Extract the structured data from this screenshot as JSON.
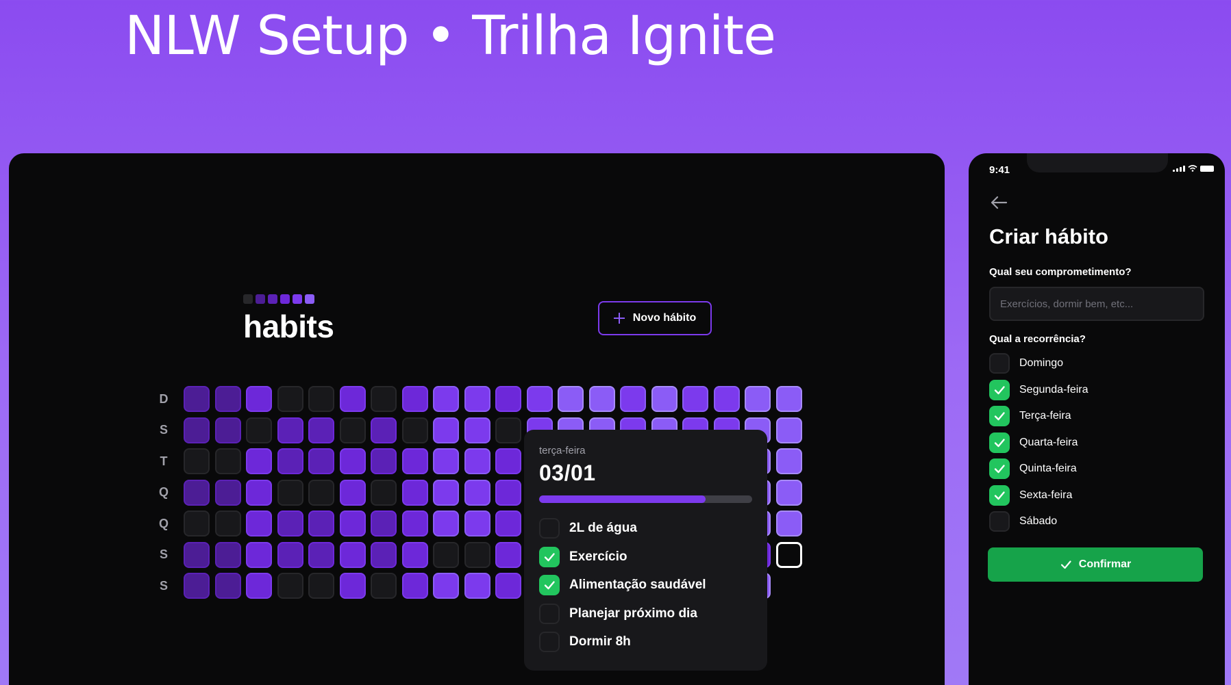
{
  "banner": {
    "title": "NLW Setup • Trilha Ignite"
  },
  "desktop": {
    "logo_text": "habits",
    "logo_squares": [
      "#27272a",
      "#4c1d95",
      "#5b21b6",
      "#6d28d9",
      "#7c3aed",
      "#8b5cf6"
    ],
    "new_habit_label": "Novo hábito",
    "weekdays": [
      "D",
      "S",
      "T",
      "Q",
      "Q",
      "S",
      "S"
    ],
    "heatmap_levels": [
      [
        1,
        1,
        3,
        0,
        0,
        3,
        0,
        3,
        4,
        4,
        3,
        4,
        5,
        5,
        4,
        5,
        4,
        4,
        5,
        5
      ],
      [
        1,
        1,
        0,
        2,
        2,
        0,
        2,
        0,
        4,
        4,
        0,
        4,
        5,
        5,
        4,
        5,
        4,
        4,
        5,
        5
      ],
      [
        0,
        0,
        3,
        2,
        2,
        3,
        2,
        3,
        4,
        4,
        3,
        4,
        5,
        5,
        4,
        5,
        4,
        4,
        5,
        5
      ],
      [
        1,
        1,
        3,
        0,
        0,
        3,
        0,
        3,
        4,
        4,
        3,
        4,
        5,
        5,
        4,
        5,
        4,
        4,
        5,
        5
      ],
      [
        0,
        0,
        3,
        2,
        2,
        3,
        2,
        3,
        4,
        4,
        3,
        4,
        5,
        5,
        4,
        5,
        4,
        4,
        5,
        5
      ],
      [
        1,
        1,
        3,
        2,
        2,
        3,
        2,
        3,
        0,
        0,
        3,
        4,
        5,
        5,
        4,
        5,
        4,
        4,
        3,
        "T"
      ],
      [
        1,
        1,
        3,
        0,
        0,
        3,
        0,
        3,
        4,
        4,
        3,
        4,
        5,
        5,
        4,
        5,
        4,
        4,
        5,
        null
      ]
    ],
    "popover": {
      "weekday": "terça-feira",
      "date": "03/01",
      "progress": 0.78,
      "habits": [
        {
          "label": "2L de água",
          "checked": false
        },
        {
          "label": "Exercício",
          "checked": true
        },
        {
          "label": "Alimentação saudável",
          "checked": true
        },
        {
          "label": "Planejar próximo dia",
          "checked": false
        },
        {
          "label": "Dormir 8h",
          "checked": false
        }
      ]
    }
  },
  "phone": {
    "time": "9:41",
    "title": "Criar hábito",
    "question_commitment": "Qual seu comprometimento?",
    "input_placeholder": "Exercícios, dormir bem, etc...",
    "question_recurrence": "Qual a recorrência?",
    "days": [
      {
        "label": "Domingo",
        "checked": false
      },
      {
        "label": "Segunda-feira",
        "checked": true
      },
      {
        "label": "Terça-feira",
        "checked": true
      },
      {
        "label": "Quarta-feira",
        "checked": true
      },
      {
        "label": "Quinta-feira",
        "checked": true
      },
      {
        "label": "Sexta-feira",
        "checked": true
      },
      {
        "label": "Sábado",
        "checked": false
      }
    ],
    "confirm_label": "Confirmar"
  }
}
